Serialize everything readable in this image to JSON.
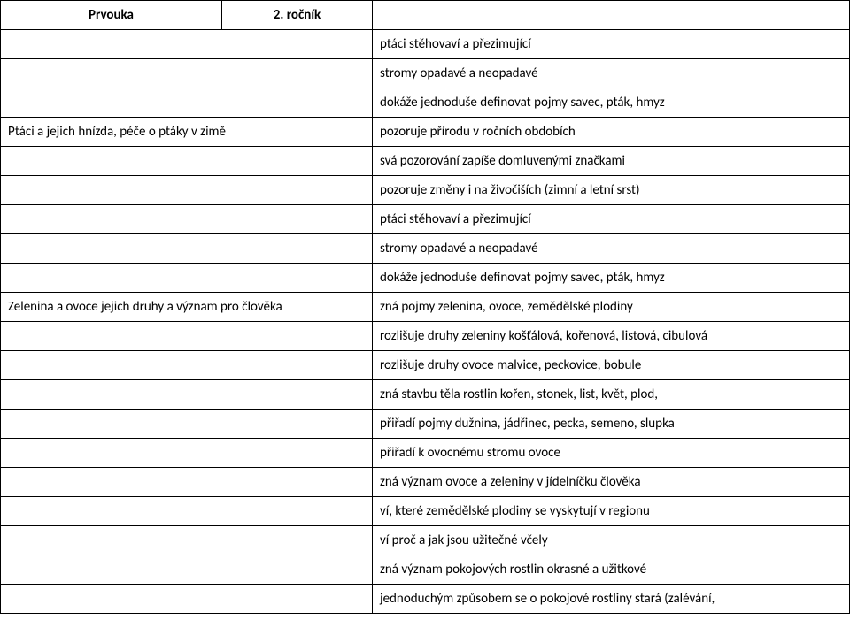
{
  "header": {
    "subject": "Prvouka",
    "grade": "2. ročník"
  },
  "rows": [
    {
      "left": "",
      "right": "ptáci stěhovaví a přezimující"
    },
    {
      "left": "",
      "right": "stromy opadavé a neopadavé"
    },
    {
      "left": "",
      "right": "dokáže jednoduše definovat pojmy savec, pták, hmyz"
    },
    {
      "left": "Ptáci a jejich hnízda, péče o ptáky v zimě",
      "right": "pozoruje přírodu v ročních obdobích"
    },
    {
      "left": "",
      "right": "svá pozorování zapíše domluvenými značkami"
    },
    {
      "left": "",
      "right": "pozoruje změny i na živočiších (zimní a letní srst)"
    },
    {
      "left": "",
      "right": "ptáci stěhovaví a přezimující"
    },
    {
      "left": "",
      "right": "stromy opadavé a neopadavé"
    },
    {
      "left": "",
      "right": "dokáže jednoduše definovat pojmy savec, pták, hmyz"
    },
    {
      "left": "Zelenina a ovoce jejich druhy a význam pro člověka",
      "right": "zná pojmy zelenina, ovoce, zemědělské plodiny"
    },
    {
      "left": "",
      "right": "rozlišuje druhy zeleniny košťálová, kořenová, listová, cibulová",
      "justify": true
    },
    {
      "left": "",
      "right": "rozlišuje druhy ovoce malvice, peckovice, bobule"
    },
    {
      "left": "",
      "right": "zná stavbu těla rostlin kořen, stonek, list, květ, plod,"
    },
    {
      "left": "",
      "right": "přiřadí pojmy dužnina, jádřinec, pecka, semeno, slupka"
    },
    {
      "left": "",
      "right": "přiřadí k ovocnému stromu ovoce"
    },
    {
      "left": "",
      "right": "zná význam ovoce a zeleniny v jídelníčku člověka"
    },
    {
      "left": "",
      "right": "ví, které zemědělské plodiny se vyskytují v regionu"
    },
    {
      "left": "",
      "right": "ví proč a jak jsou užitečné včely"
    },
    {
      "left": "",
      "right": "zná význam pokojových rostlin okrasné a užitkové"
    },
    {
      "left": "",
      "right": "jednoduchým způsobem se o pokojové rostliny stará (zalévání,"
    }
  ]
}
